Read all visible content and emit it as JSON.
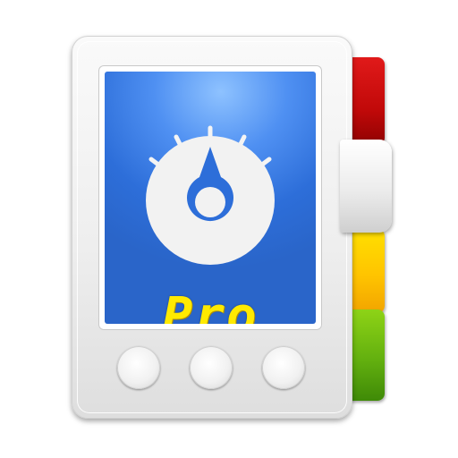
{
  "app_icon": {
    "name": "device-settings-app-icon",
    "screen": {
      "glyph": "dial-gauge-icon",
      "label": "Pro"
    },
    "side_tabs": [
      "red",
      "white",
      "yellow",
      "green"
    ],
    "hardware_buttons": 3,
    "colors": {
      "screen_blue": "#2d6ed9",
      "label_yellow": "#ffea00",
      "tab_red": "#d01010",
      "tab_yellow": "#ffcc00",
      "tab_green": "#5aaa10",
      "body_white": "#f2f2f2"
    }
  }
}
